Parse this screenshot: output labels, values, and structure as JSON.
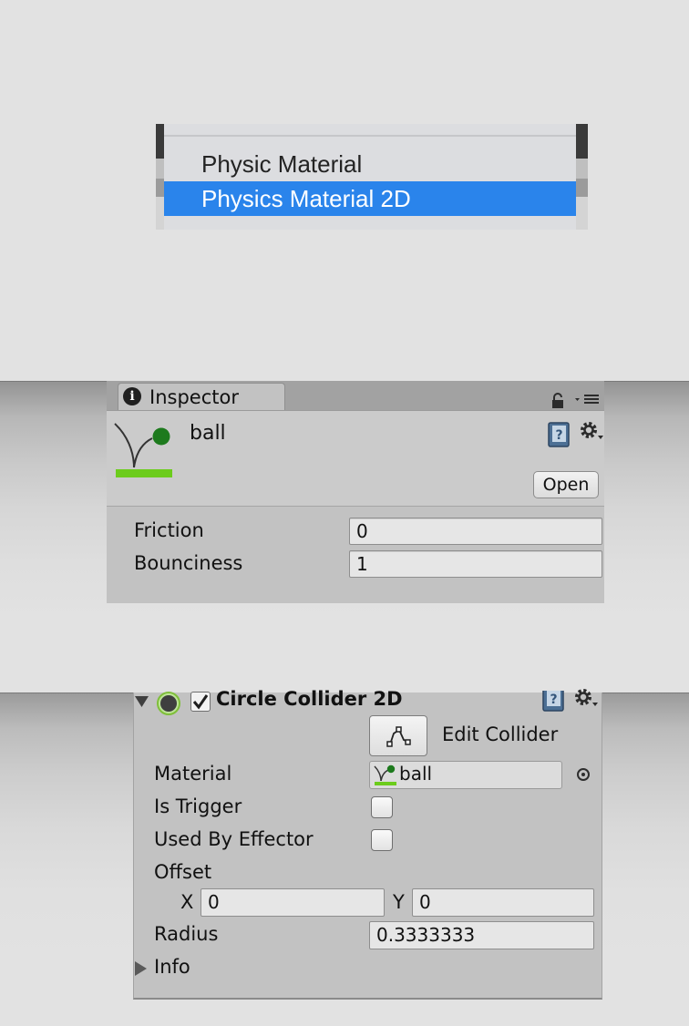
{
  "menu": {
    "items": [
      {
        "label": "Physic Material",
        "selected": false
      },
      {
        "label": "Physics Material 2D",
        "selected": true
      }
    ],
    "highlight_color": "#2a84eb"
  },
  "inspector": {
    "tab_label": "Inspector",
    "tab_icon": "info-icon",
    "asset_name": "ball",
    "asset_icon": "physics-material-2d-icon",
    "open_label": "Open",
    "properties": [
      {
        "label": "Friction",
        "value": "0"
      },
      {
        "label": "Bounciness",
        "value": "1"
      }
    ]
  },
  "collider": {
    "title": "Circle Collider 2D",
    "enabled": true,
    "edit_label": "Edit Collider",
    "material_label": "Material",
    "material_value": "ball",
    "is_trigger_label": "Is Trigger",
    "is_trigger": false,
    "used_by_effector_label": "Used By Effector",
    "used_by_effector": false,
    "offset_label": "Offset",
    "offset_x_label": "X",
    "offset_x": "0",
    "offset_y_label": "Y",
    "offset_y": "0",
    "radius_label": "Radius",
    "radius": "0.3333333",
    "info_label": "Info"
  }
}
